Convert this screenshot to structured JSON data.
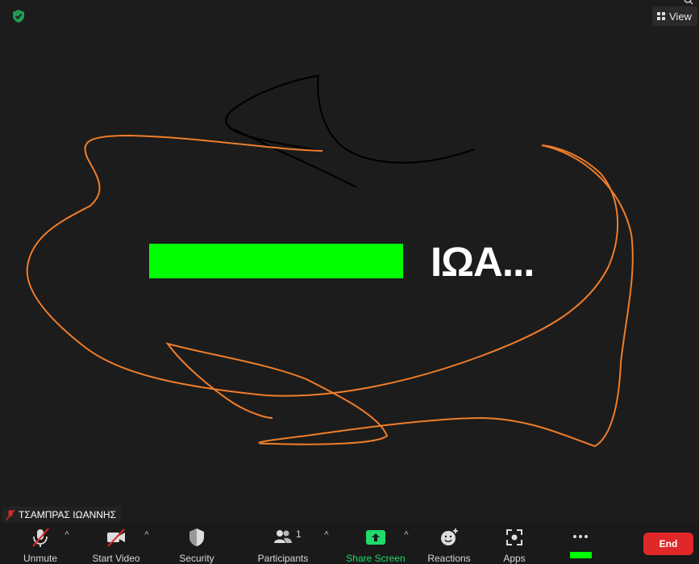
{
  "meeting": {
    "view_label": "View",
    "shared_name_text": "ΙΩΑ...",
    "participant_name": "ΤΣΑΜΠΡΑΣ ΙΩΑΝΝΗΣ",
    "participants_count": "1"
  },
  "toolbar": {
    "unmute": "Unmute",
    "start_video": "Start Video",
    "security": "Security",
    "participants": "Participants",
    "share_screen": "Share Screen",
    "reactions": "Reactions",
    "apps": "Apps",
    "end": "End"
  },
  "colors": {
    "background": "#1c1c1c",
    "highlight_green": "#00ff00",
    "annotation_orange": "#f07d2a",
    "annotation_black": "#000000",
    "share_green": "#22d96b",
    "end_red": "#e02828",
    "muted_red": "#e02828"
  },
  "icons": [
    "shield-icon",
    "grid-icon",
    "search-icon",
    "mic-muted-icon",
    "video-off-icon",
    "shield-security-icon",
    "participants-icon",
    "share-arrow-icon",
    "reactions-icon",
    "apps-icon",
    "more-icon"
  ]
}
